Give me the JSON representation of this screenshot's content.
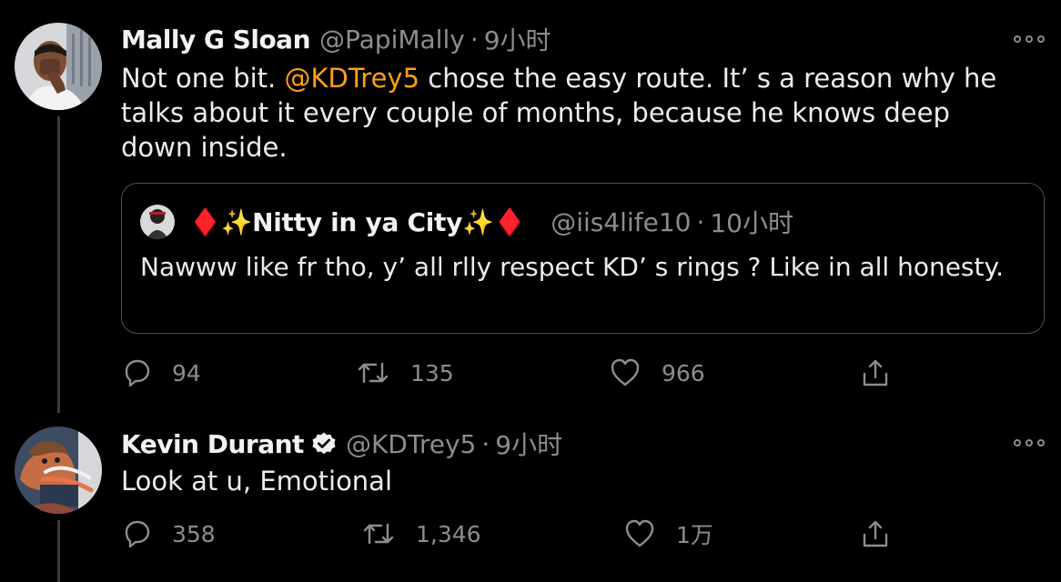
{
  "colors": {
    "background": "#000000",
    "text": "#ececec",
    "muted": "#8a8d91",
    "mention": "#ff9f1a",
    "verified": "#f0f0f0"
  },
  "tweets": [
    {
      "name": "Mally G Sloan",
      "handle": "@PapiMally",
      "dot": "·",
      "time": "9小时",
      "text_before": "Not one bit. ",
      "mention": "@KDTrey5",
      "text_after": " chose the easy route. It’ s a reason why he talks about it every couple of months, because he knows deep down inside.",
      "quote": {
        "name": "♦️✨Nitty in ya City✨♦️",
        "handle": "@iis4life10",
        "dot": "·",
        "time": "10小时",
        "text": "Nawww like fr tho, y’ all rlly respect KD’ s rings ? Like in all honesty."
      },
      "actions": {
        "replies": "94",
        "retweets": "135",
        "likes": "966"
      },
      "icons": [
        "reply-icon",
        "retweet-icon",
        "like-icon",
        "share-icon",
        "more-icon"
      ]
    },
    {
      "name": "Kevin Durant",
      "handle": "@KDTrey5",
      "dot": "·",
      "time": "9小时",
      "verified": true,
      "text": "Look at u, Emotional",
      "actions": {
        "replies": "358",
        "retweets": "1,346",
        "likes": "1万"
      },
      "icons": [
        "verified-icon",
        "reply-icon",
        "retweet-icon",
        "like-icon",
        "share-icon",
        "more-icon"
      ]
    }
  ]
}
